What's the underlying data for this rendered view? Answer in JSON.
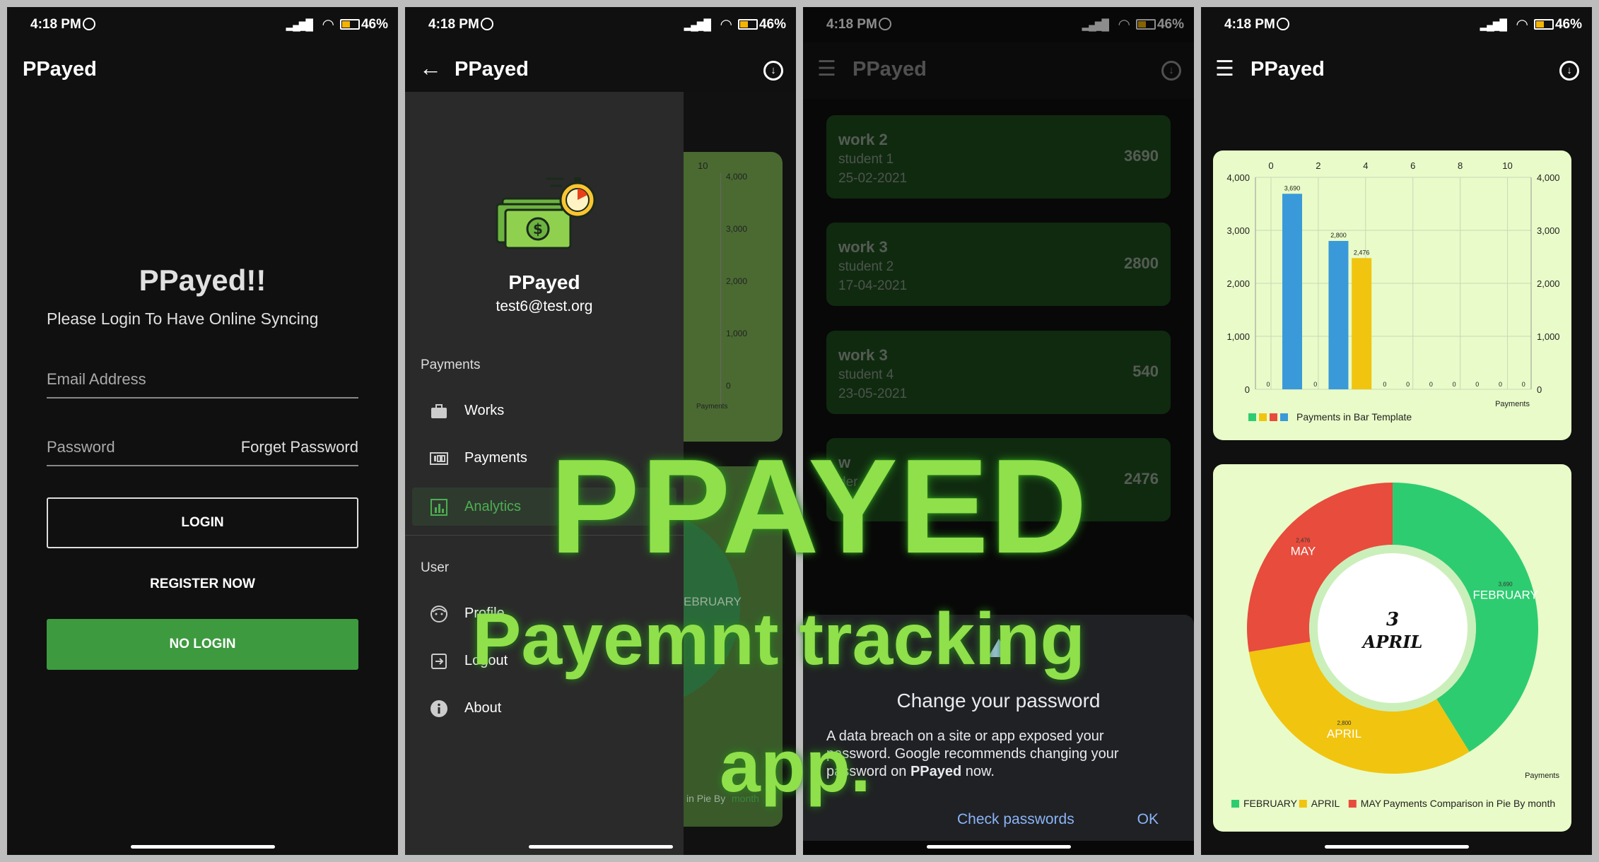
{
  "status": {
    "time": "4:18 PM",
    "battery": "46%"
  },
  "app": {
    "title": "PPayed"
  },
  "login": {
    "heading": "PPayed!!",
    "subtitle": "Please Login To Have Online Syncing",
    "email_placeholder": "Email Address",
    "password_placeholder": "Password",
    "forgot": "Forget Password",
    "login_btn": "LOGIN",
    "register_btn": "REGISTER NOW",
    "nologin_btn": "NO LOGIN"
  },
  "drawer": {
    "user_name": "PPayed",
    "user_email": "test6@test.org",
    "section_payments": "Payments",
    "items_payments": [
      {
        "label": "Works",
        "icon": "briefcase-icon"
      },
      {
        "label": "Payments",
        "icon": "money-icon"
      },
      {
        "label": "Analytics",
        "icon": "chart-icon"
      }
    ],
    "section_user": "User",
    "items_user": [
      {
        "label": "Profile",
        "icon": "face-icon"
      },
      {
        "label": "Logout",
        "icon": "logout-icon"
      },
      {
        "label": "About",
        "icon": "info-icon"
      }
    ],
    "behind_text": {
      "pie_label": "EBRUARY",
      "footer": "in Pie By",
      "footer_green": "month",
      "bar_top": "10",
      "bar_ticks": [
        "4,000",
        "3,000",
        "2,000",
        "1,000",
        "0"
      ],
      "bar_footer": "Payments"
    }
  },
  "works": [
    {
      "title": "work 2",
      "student": "student 1",
      "date": "25-02-2021",
      "amount": "3690"
    },
    {
      "title": "work 3",
      "student": "student 2",
      "date": "17-04-2021",
      "amount": "2800"
    },
    {
      "title": "work 3",
      "student": "student 4",
      "date": "23-05-2021",
      "amount": "540"
    },
    {
      "title": "w",
      "student": "der",
      "date": "3-05",
      "amount": "2476"
    }
  ],
  "dialog": {
    "title": "Change your password",
    "body_pre": "A data breach on a site or app exposed your password. Google recommends changing your password on ",
    "body_app": "PPayed",
    "body_post": " now.",
    "action_check": "Check passwords",
    "action_ok": "OK"
  },
  "overlay": {
    "title": "PPAYED",
    "tagline_1": "Payemnt tracking",
    "tagline_2": "app."
  },
  "colors": {
    "accent": "#3d9a3f",
    "chart_bg": "#e9fbc8",
    "blue": "#3a9ad9",
    "yellow": "#f1c40f",
    "red": "#e74c3c",
    "green": "#2ecc71"
  },
  "chart_data": [
    {
      "type": "bar",
      "title": "",
      "legend": "Payments in Bar Template",
      "x_ticks": [
        0,
        2,
        4,
        6,
        8,
        10
      ],
      "y_ticks": [
        "4,000",
        "3,000",
        "2,000",
        "1,000",
        "0"
      ],
      "ylim": [
        0,
        4000
      ],
      "xlabel": "Payments",
      "categories": [
        1,
        2,
        3,
        4,
        5,
        6,
        7,
        8,
        9,
        10,
        11
      ],
      "values": [
        3690,
        0,
        2800,
        2476,
        0,
        0,
        0,
        0,
        0,
        0,
        0
      ],
      "bar_labels": [
        "3,690",
        "0",
        "2,800",
        "2,476",
        "0",
        "0",
        "0",
        "0",
        "0",
        "0",
        "0"
      ],
      "zero_left_label": "0",
      "bar_colors": [
        "#3a9ad9",
        "#3a9ad9",
        "#3a9ad9",
        "#f1c40f",
        "#3a9ad9",
        "#3a9ad9",
        "#3a9ad9",
        "#3a9ad9",
        "#3a9ad9",
        "#3a9ad9",
        "#3a9ad9"
      ],
      "legend_colors": [
        "#2ecc71",
        "#f1c40f",
        "#e74c3c",
        "#3a9ad9"
      ]
    },
    {
      "type": "pie",
      "legend": "Payments Comparison in Pie By month",
      "corner_label": "Payments",
      "center_text": [
        "3",
        "APRIL"
      ],
      "slices": [
        {
          "name": "FEBRUARY",
          "value": 3690,
          "value_label": "3,690",
          "color": "#2ecc71"
        },
        {
          "name": "APRIL",
          "value": 2800,
          "value_label": "2,800",
          "color": "#f1c40f"
        },
        {
          "name": "MAY",
          "value": 2476,
          "value_label": "2,476",
          "color": "#e74c3c"
        }
      ]
    }
  ]
}
